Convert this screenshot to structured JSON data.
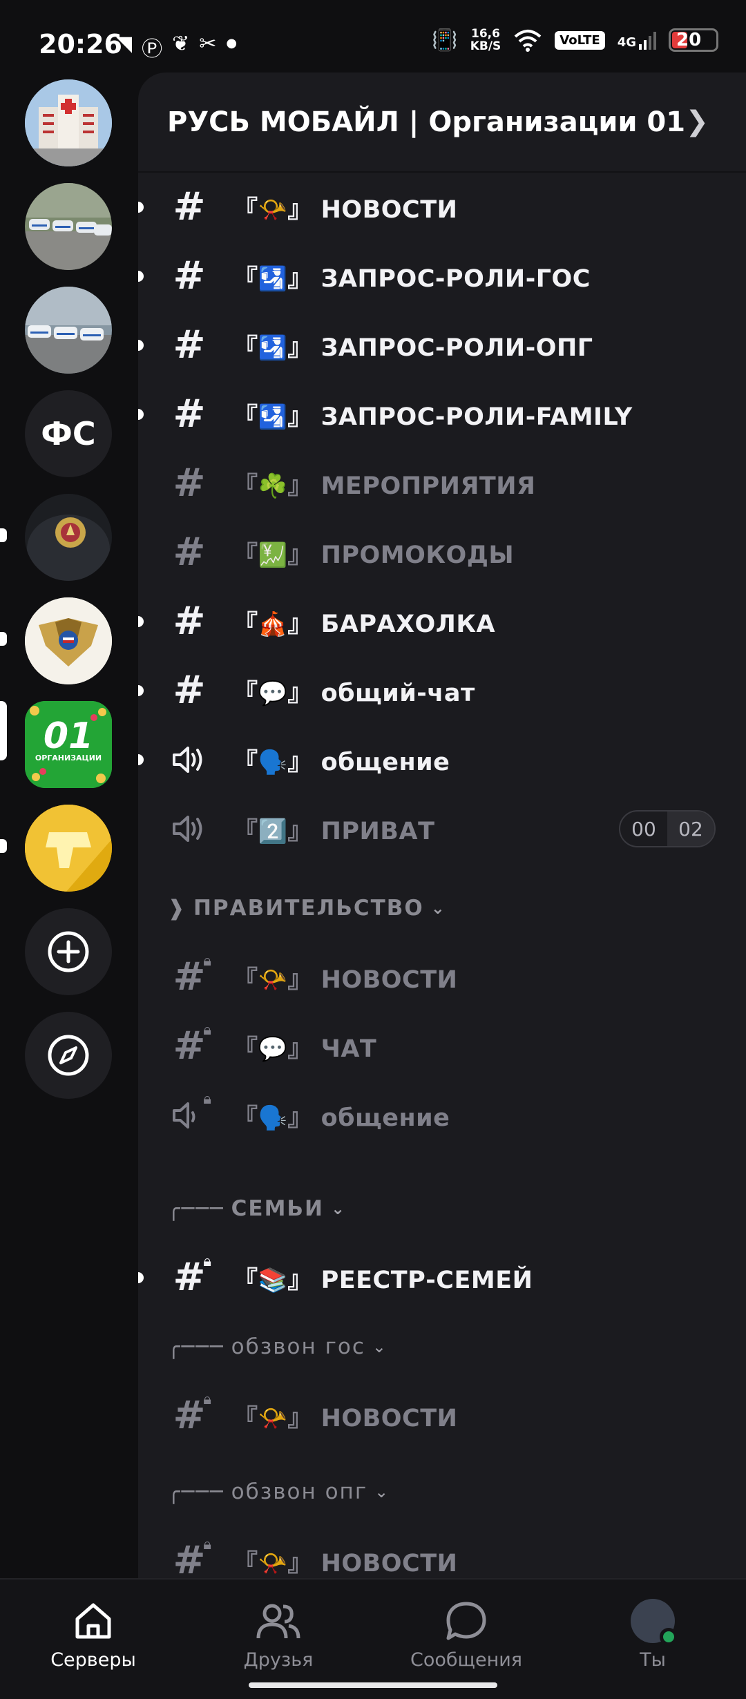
{
  "status": {
    "time": "20:26",
    "net_speed": "16,6",
    "net_speed_unit": "KB/S",
    "volte": "VoLTE",
    "network": "4G",
    "battery": "20"
  },
  "servers": [
    {
      "name": "hospital-server-icon"
    },
    {
      "name": "police-cars-server-icon"
    },
    {
      "name": "police-cars-server-icon-2"
    },
    {
      "name": "fs-server",
      "initials": "ФС"
    },
    {
      "name": "fsb-server-icon"
    },
    {
      "name": "government-eagle-server-icon"
    },
    {
      "name": "organizations-01-server-icon",
      "badge_text": "01",
      "badge_sub": "ОРГАНИЗАЦИИ"
    },
    {
      "name": "yellow-server-icon"
    }
  ],
  "guild": {
    "title": "РУСЬ МОБАЙЛ | Организации 01"
  },
  "channels": {
    "c1": {
      "open": "『",
      "emoji": "📯",
      "close": "』",
      "label": "НОВОСТИ"
    },
    "c2": {
      "open": "『",
      "emoji": "🛂",
      "close": "』",
      "label": "ЗАПРОС-РОЛИ-ГОС"
    },
    "c3": {
      "open": "『",
      "emoji": "🛂",
      "close": "』",
      "label": "ЗАПРОС-РОЛИ-ОПГ"
    },
    "c4": {
      "open": "『",
      "emoji": "🛂",
      "close": "』",
      "label": "ЗАПРОС-РОЛИ-FAMILY"
    },
    "c5": {
      "open": "『",
      "emoji": "☘️",
      "close": "』",
      "label": "МЕРОПРИЯТИЯ"
    },
    "c6": {
      "open": "『",
      "emoji": "💹",
      "close": "』",
      "label": "ПРОМОКОДЫ"
    },
    "c7": {
      "open": "『",
      "emoji": "🎪",
      "close": "』",
      "label": "БАРАХОЛКА"
    },
    "c8": {
      "open": "『",
      "emoji": "💬",
      "close": "』",
      "label": "общий-чат"
    },
    "c9": {
      "open": "『",
      "emoji": "🗣️",
      "close": "』",
      "label": "общение"
    },
    "c10": {
      "open": "『",
      "emoji": "2️⃣",
      "close": "』",
      "label": "ПРИВАТ",
      "users": "00",
      "limit": "02"
    },
    "c11": {
      "open": "『",
      "emoji": "📯",
      "close": "』",
      "label": "НОВОСТИ"
    },
    "c12": {
      "open": "『",
      "emoji": "💬",
      "close": "』",
      "label": "ЧАТ"
    },
    "c13": {
      "open": "『",
      "emoji": "🗣️",
      "close": "』",
      "label": "общение"
    },
    "c14": {
      "open": "『",
      "emoji": "📚",
      "close": "』",
      "label": "РЕЕСТР-СЕМЕЙ"
    },
    "c15": {
      "open": "『",
      "emoji": "📯",
      "close": "』",
      "label": "НОВОСТИ"
    },
    "c16": {
      "open": "『",
      "emoji": "📯",
      "close": "』",
      "label": "НОВОСТИ"
    }
  },
  "categories": {
    "gov": {
      "prefix": "❱",
      "label": "ПРАВИТЕЛЬСТВО"
    },
    "families": {
      "prefix": "╭───",
      "label": "СЕМЬИ"
    },
    "call_gov": {
      "prefix": "╭───",
      "label": "обзвон гос"
    },
    "call_opg": {
      "prefix": "╭───",
      "label": "обзвон опг"
    }
  },
  "nav": {
    "servers": "Серверы",
    "friends": "Друзья",
    "messages": "Сообщения",
    "you": "Ты"
  }
}
